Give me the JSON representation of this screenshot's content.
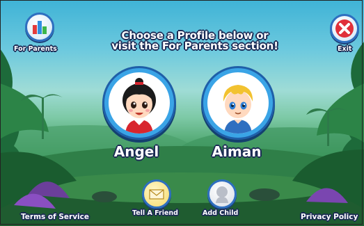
{
  "header": {
    "headline_line1": "Choose a Profile below or",
    "headline_line2": "visit the For Parents section!"
  },
  "top_buttons": {
    "for_parents_label": "For Parents",
    "exit_label": "Exit"
  },
  "profiles": [
    {
      "name": "Angel",
      "avatar": "girl-avatar-icon"
    },
    {
      "name": "Aiman",
      "avatar": "boy-avatar-icon"
    }
  ],
  "bottom_buttons": {
    "tell_a_friend_label": "Tell A Friend",
    "add_child_label": "Add Child"
  },
  "footer": {
    "terms_label": "Terms of Service",
    "privacy_label": "Privacy Policy"
  },
  "colors": {
    "button_blue": "#2e6fc0",
    "exit_red": "#e0303a",
    "text_outline": "#1b2a55"
  },
  "icons": {
    "for_parents": "bar-chart-icon",
    "exit": "close-icon",
    "tell_a_friend": "envelope-icon",
    "add_child": "child-silhouette-icon"
  }
}
